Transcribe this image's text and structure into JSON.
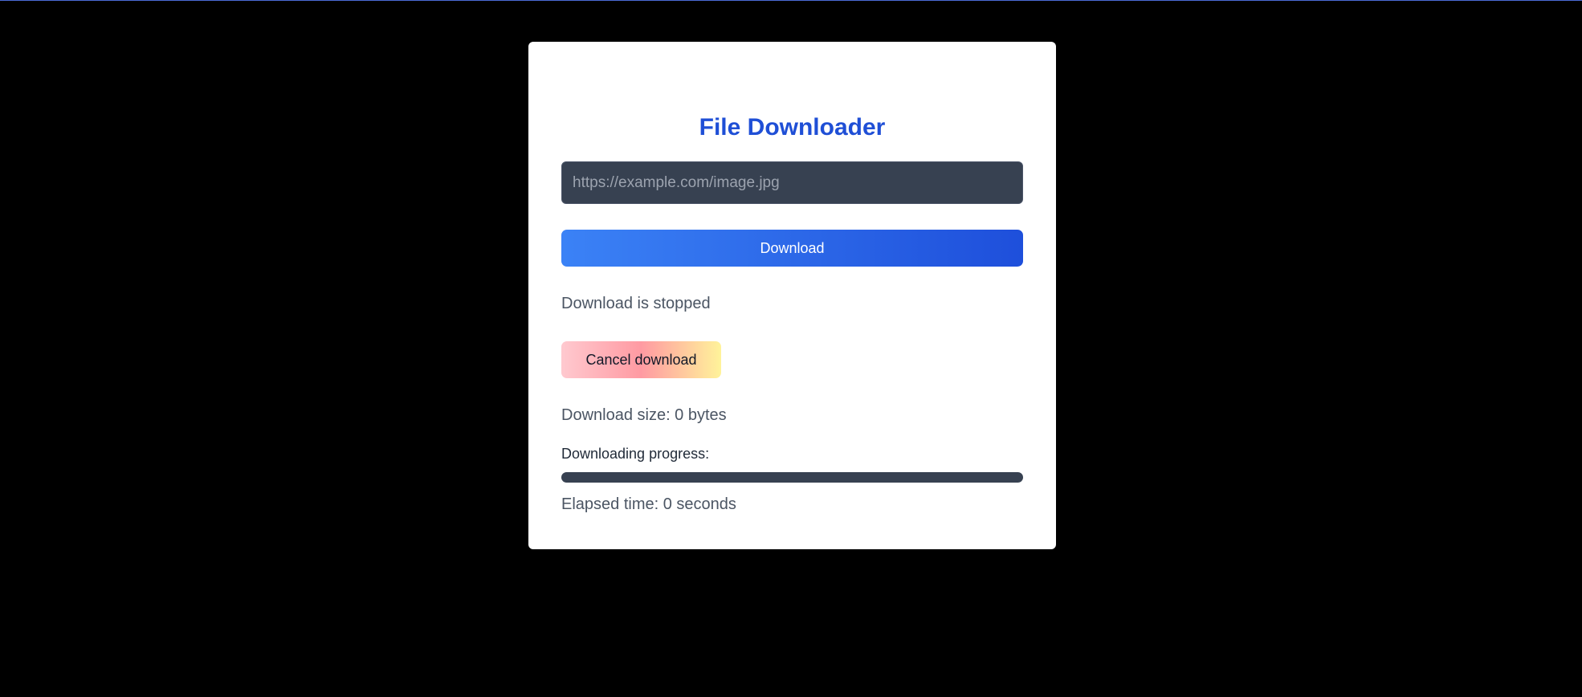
{
  "app": {
    "title": "File Downloader"
  },
  "form": {
    "url_value": "",
    "url_placeholder": "https://example.com/image.jpg",
    "download_label": "Download"
  },
  "status": {
    "text": "Download is stopped"
  },
  "actions": {
    "cancel_label": "Cancel download"
  },
  "info": {
    "size_text": "Download size: 0 bytes",
    "progress_label": "Downloading progress:",
    "progress_value": 0,
    "elapsed_text": "Elapsed time: 0 seconds"
  },
  "colors": {
    "background": "#000000",
    "card": "#ffffff",
    "title": "#1f4fd6",
    "input_bg": "#374151",
    "primary_start": "#3b82f6",
    "primary_end": "#1e4fdb",
    "progress_track": "#374151"
  }
}
